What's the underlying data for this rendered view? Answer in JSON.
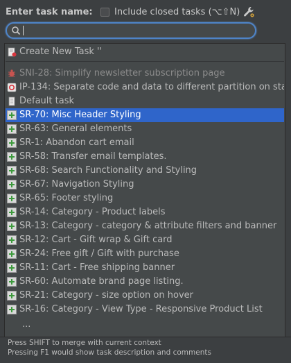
{
  "header": {
    "enter_label": "Enter task name:",
    "include_closed_label": "Include closed tasks (⌥⇧N)",
    "include_closed_checked": false
  },
  "search": {
    "value": "",
    "placeholder": ""
  },
  "create_new": {
    "label": "Create New Task ''",
    "icon": "new-task-icon"
  },
  "items": [
    {
      "label": "SNI-28: Simplify newsletter subscription page",
      "icon": "bug-icon",
      "state": "dim"
    },
    {
      "label": "IP-134: Separate code and data to different partition on sta...",
      "icon": "youtrack-icon",
      "state": "normal"
    },
    {
      "label": "Default task",
      "icon": "document-icon",
      "state": "normal"
    },
    {
      "label": "SR-70: Misc Header Styling",
      "icon": "plus-icon",
      "state": "selected"
    },
    {
      "label": "SR-63: General elements",
      "icon": "plus-icon",
      "state": "normal"
    },
    {
      "label": "SR-1: Abandon cart email",
      "icon": "plus-icon",
      "state": "normal"
    },
    {
      "label": "SR-58: Transfer email templates.",
      "icon": "plus-icon",
      "state": "normal"
    },
    {
      "label": "SR-68: Search Functionality and Styling",
      "icon": "plus-icon",
      "state": "normal"
    },
    {
      "label": "SR-67: Navigation Styling",
      "icon": "plus-icon",
      "state": "normal"
    },
    {
      "label": "SR-65: Footer styling",
      "icon": "plus-icon",
      "state": "normal"
    },
    {
      "label": "SR-14: Category - Product labels",
      "icon": "plus-icon",
      "state": "normal"
    },
    {
      "label": "SR-13: Category - category & attribute filters and banner",
      "icon": "plus-icon",
      "state": "normal"
    },
    {
      "label": "SR-12: Cart - Gift wrap & Gift card",
      "icon": "plus-icon",
      "state": "normal"
    },
    {
      "label": "SR-24: Free gift / Gift with purchase",
      "icon": "plus-icon",
      "state": "normal"
    },
    {
      "label": "SR-11: Cart - Free shipping banner",
      "icon": "plus-icon",
      "state": "normal"
    },
    {
      "label": "SR-60: Automate brand page listing.",
      "icon": "plus-icon",
      "state": "normal"
    },
    {
      "label": "SR-21: Category - size option on hover",
      "icon": "plus-icon",
      "state": "normal"
    },
    {
      "label": "SR-16: Category - View Type - Responsive Product List",
      "icon": "plus-icon",
      "state": "normal"
    }
  ],
  "more_indicator": "...",
  "footer": {
    "hint1": "Press SHIFT to merge with current context",
    "hint2": "Pressing F1 would show task description and comments"
  },
  "colors": {
    "background": "#3c3f41",
    "popup": "#45494a",
    "selection": "#2f65ca",
    "focus_ring": "#4e84c8"
  }
}
